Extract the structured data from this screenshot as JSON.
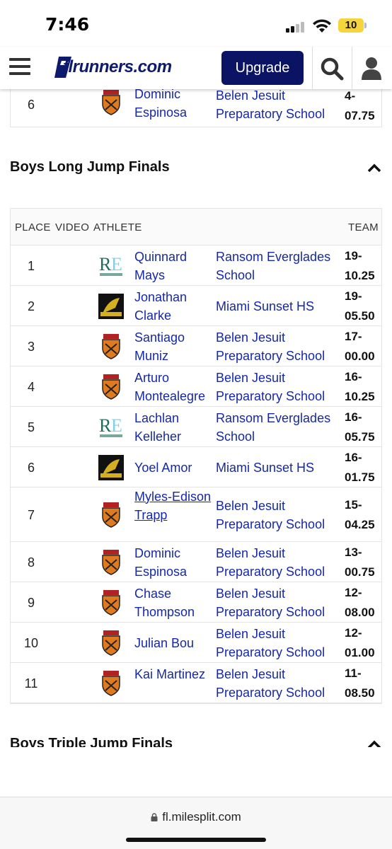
{
  "status_bar": {
    "time": "7:46",
    "battery": "10"
  },
  "header": {
    "logo_text": "flrunners.com",
    "upgrade_label": "Upgrade"
  },
  "previous_row": {
    "place": "6",
    "athlete": "Dominic Espinosa",
    "team": "Belen Jesuit Preparatory School",
    "mark": "4-07.75",
    "school_logo": "belen-shield"
  },
  "long_jump": {
    "title": "Boys Long Jump Finals",
    "columns": {
      "place": "PLACE",
      "video": "VIDEO",
      "athlete": "ATHLETE",
      "team": "TEAM"
    },
    "rows": [
      {
        "place": "1",
        "athlete": "Quinnard Mays",
        "team": "Ransom Everglades School",
        "mark": "19-10.25",
        "school_logo": "ransom-re"
      },
      {
        "place": "2",
        "athlete": "Jonathan Clarke",
        "team": "Miami Sunset HS",
        "mark": "19-05.50",
        "school_logo": "sunset"
      },
      {
        "place": "3",
        "athlete": "Santiago Muniz",
        "team": "Belen Jesuit Preparatory School",
        "mark": "17-00.00",
        "school_logo": "belen-shield"
      },
      {
        "place": "4",
        "athlete": "Arturo Montealegre",
        "team": "Belen Jesuit Preparatory School",
        "mark": "16-10.25",
        "school_logo": "belen-shield"
      },
      {
        "place": "5",
        "athlete": "Lachlan Kelleher",
        "team": "Ransom Everglades School",
        "mark": "16-05.75",
        "school_logo": "ransom-re"
      },
      {
        "place": "6",
        "athlete": "Yoel Amor",
        "team": "Miami Sunset HS",
        "mark": "16-01.75",
        "school_logo": "sunset"
      },
      {
        "place": "7",
        "athlete": "Myles-Edison Trapp",
        "team": "Belen Jesuit Preparatory School",
        "mark": "15-04.25",
        "school_logo": "belen-shield"
      },
      {
        "place": "8",
        "athlete": "Dominic Espinosa",
        "team": "Belen Jesuit Preparatory School",
        "mark": "13-00.75",
        "school_logo": "belen-shield"
      },
      {
        "place": "9",
        "athlete": "Chase Thompson",
        "team": "Belen Jesuit Preparatory School",
        "mark": "12-08.00",
        "school_logo": "belen-shield"
      },
      {
        "place": "10",
        "athlete": "Julian Bou",
        "team": "Belen Jesuit Preparatory School",
        "mark": "12-01.00",
        "school_logo": "belen-shield"
      },
      {
        "place": "11",
        "athlete": "Kai Martinez",
        "team": "Belen Jesuit Preparatory School",
        "mark": "11-08.50",
        "school_logo": "belen-shield"
      }
    ]
  },
  "triple_jump": {
    "title": "Boys Triple Jump Finals"
  },
  "url_bar": {
    "url": "fl.milesplit.com"
  },
  "colors": {
    "link": "#1528a8",
    "brand_navy": "#0b1464",
    "battery": "#f6d43c"
  }
}
